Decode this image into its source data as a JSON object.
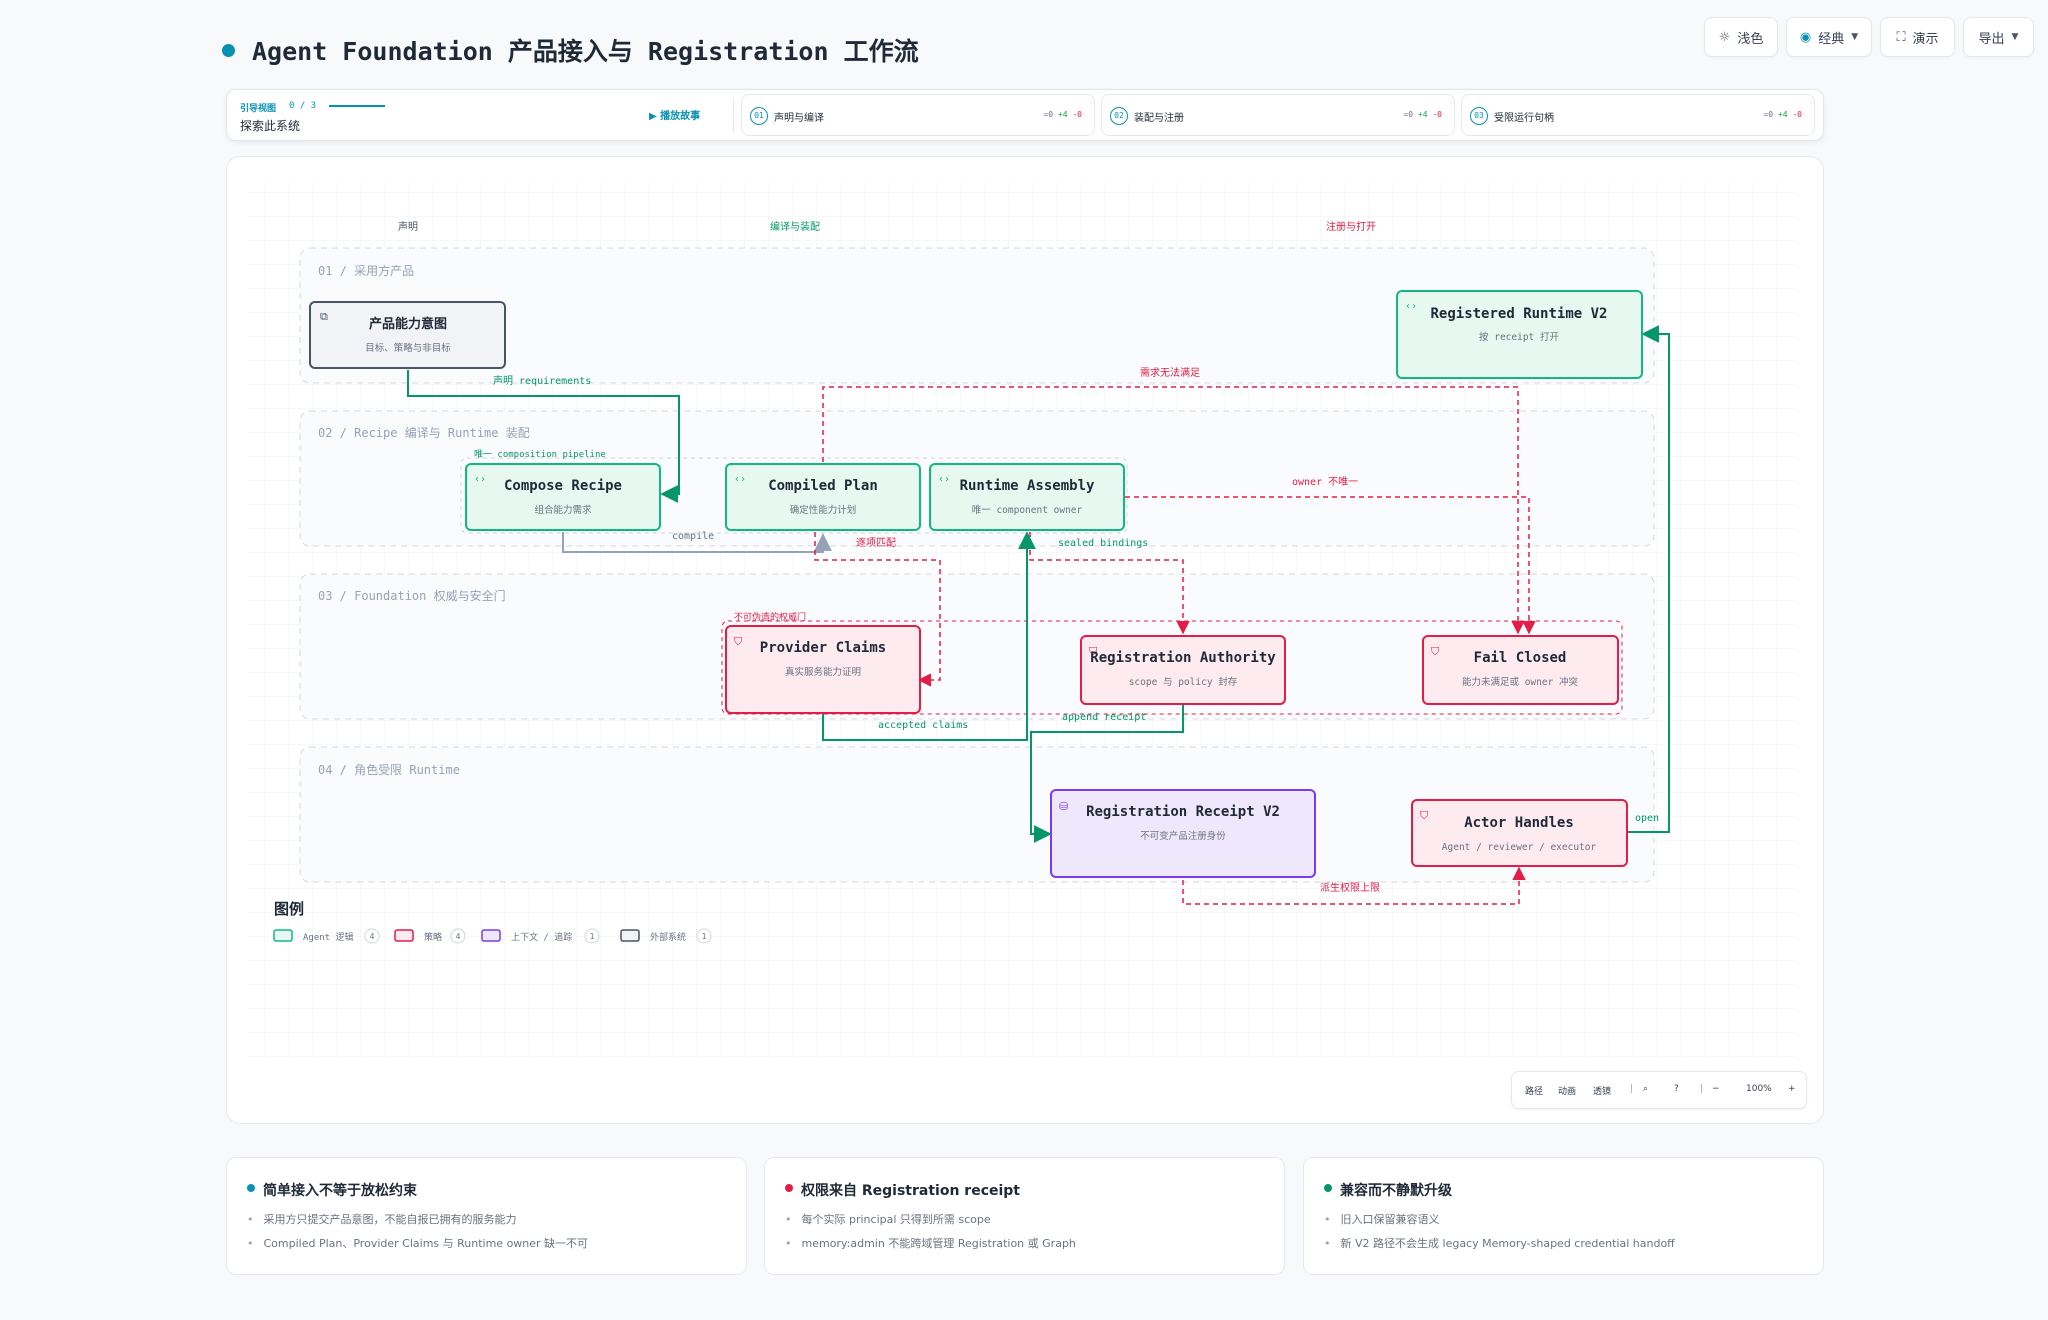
{
  "header": {
    "title": "Agent Foundation 产品接入与 Registration 工作流",
    "buttons": {
      "theme": "浅色",
      "style": "经典",
      "present": "演示",
      "export": "导出"
    }
  },
  "guide": {
    "label": "引导视图",
    "counter": "0 / 3",
    "subtitle": "探索此系统",
    "play": "播放故事",
    "steps": [
      {
        "num": "01",
        "label": "声明与编译",
        "zero": "=0",
        "plus": "+4",
        "minus": "-0"
      },
      {
        "num": "02",
        "label": "装配与注册",
        "zero": "=0",
        "plus": "+4",
        "minus": "-0"
      },
      {
        "num": "03",
        "label": "受限运行句柄",
        "zero": "=0",
        "plus": "+4",
        "minus": "-0"
      }
    ]
  },
  "columns": {
    "declare": "声明",
    "compile": "编译与装配",
    "register": "注册与打开"
  },
  "lanes": {
    "l1": "01 / 采用方产品",
    "l2": "02 / Recipe 编译与 Runtime 装配",
    "l3": "03 / Foundation 权威与安全门",
    "l4": "04 / 角色受限 Runtime"
  },
  "nodes": {
    "intent": {
      "title": "产品能力意图",
      "sub": "目标、策略与非目标"
    },
    "recipe": {
      "title": "Compose Recipe",
      "sub": "组合能力需求"
    },
    "plan": {
      "title": "Compiled Plan",
      "sub": "确定性能力计划"
    },
    "assembly": {
      "title": "Runtime Assembly",
      "sub": "唯一 component owner"
    },
    "registered": {
      "title": "Registered Runtime V2",
      "sub": "按 receipt 打开"
    },
    "claims": {
      "title": "Provider Claims",
      "sub": "真实服务能力证明"
    },
    "authority": {
      "title": "Registration Authority",
      "sub": "scope 与 policy 封存"
    },
    "failclosed": {
      "title": "Fail Closed",
      "sub": "能力未满足或 owner 冲突"
    },
    "receipt": {
      "title": "Registration Receipt V2",
      "sub": "不可变产品注册身份"
    },
    "handles": {
      "title": "Actor Handles",
      "sub": "Agent / reviewer / executor"
    }
  },
  "groups": {
    "pipeline": "唯一 composition pipeline",
    "gate": "不可伪造的权威门"
  },
  "edges": {
    "requirements": "声明 requirements",
    "compile": "compile",
    "unsatisfied": "需求无法满足",
    "owner": "owner 不唯一",
    "match": "逐项匹配",
    "sealed": "sealed bindings",
    "accepted": "accepted claims",
    "append": "append receipt",
    "open": "open",
    "derive": "派生权限上限"
  },
  "legend": {
    "title": "图例",
    "items": [
      {
        "label": "Agent 逻辑",
        "count": "4"
      },
      {
        "label": "策略",
        "count": "4"
      },
      {
        "label": "上下文 / 追踪",
        "count": "1"
      },
      {
        "label": "外部系统",
        "count": "1"
      }
    ]
  },
  "zoom": {
    "path": "路径",
    "anim": "动画",
    "lens": "透镜",
    "level": "100%",
    "minus": "−",
    "plus": "+"
  },
  "cards": [
    {
      "title": "简单接入不等于放松约束",
      "items": [
        "采用方只提交产品意图，不能自报已拥有的服务能力",
        "Compiled Plan、Provider Claims 与 Runtime owner 缺一不可"
      ]
    },
    {
      "title": "权限来自 Registration receipt",
      "items": [
        "每个实际 principal 只得到所需 scope",
        "memory:admin 不能跨域管理 Registration 或 Graph"
      ]
    },
    {
      "title": "兼容而不静默升级",
      "items": [
        "旧入口保留兼容语义",
        "新 V2 路径不会生成 legacy Memory-shaped credential handoff"
      ]
    }
  ],
  "colors": {
    "accent": "#0891b2",
    "agent": "#10b981",
    "policy": "#e11d48",
    "context": "#7c3aed",
    "external": "#475569"
  }
}
